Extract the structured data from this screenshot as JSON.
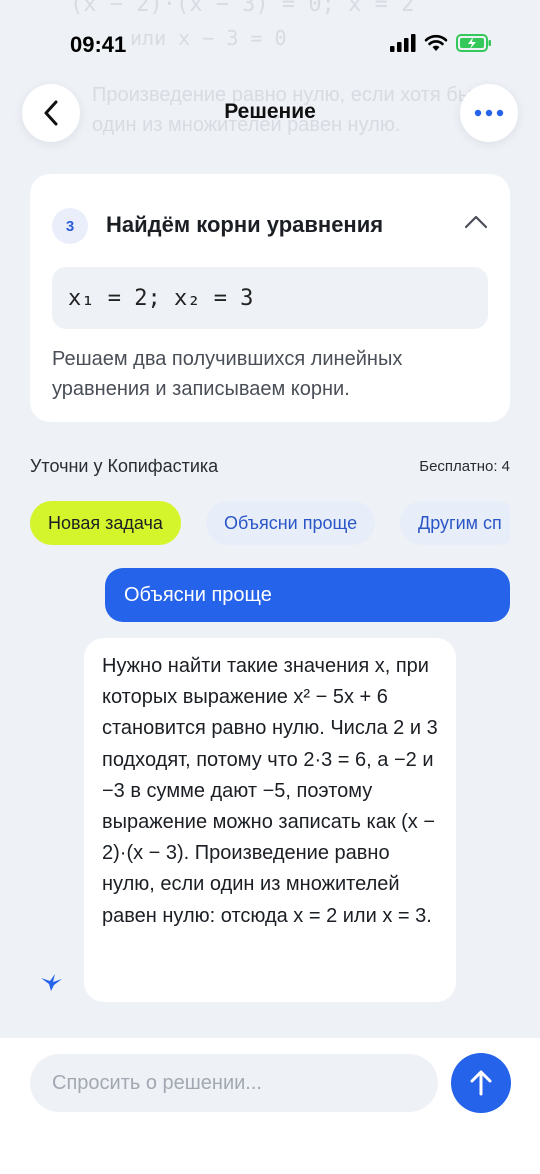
{
  "status_bar": {
    "time": "09:41"
  },
  "background_text": {
    "line1": "(x − 2)·(x − 3) = 0; x = 2",
    "line2": "или x − 3 = 0",
    "line3": "Произведение равно нулю, если хотя бы",
    "line4": "один из множителей равен нулю."
  },
  "header": {
    "title": "Решение"
  },
  "step_card": {
    "number": "3",
    "title": "Найдём корни уравнения",
    "formula": "x₁ = 2; x₂ = 3",
    "description": "Решаем два получившихся линейных уравнения и записываем корни."
  },
  "ask": {
    "label": "Уточни у Копифастика",
    "free": "Бесплатно: 4"
  },
  "chips": [
    "Новая задача",
    "Объясни проще",
    "Другим сп"
  ],
  "chat": {
    "user_message": "Объясни проще",
    "bot_message": "Нужно найти такие значения x, при которых выражение x² − 5x + 6 становится равно нулю. Числа 2 и 3 подходят, потому что 2·3 = 6, а −2 и −3 в сумме дают −5, поэтому выражение можно записать как (x − 2)·(x − 3). Произведение равно нулю, если один из множителей равен нулю: отсюда x = 2 или x = 3."
  },
  "input": {
    "placeholder": "Спросить о решении..."
  },
  "colors": {
    "accent": "#2563eb",
    "chip_primary": "#d4f52c",
    "background": "#eef1f6"
  }
}
